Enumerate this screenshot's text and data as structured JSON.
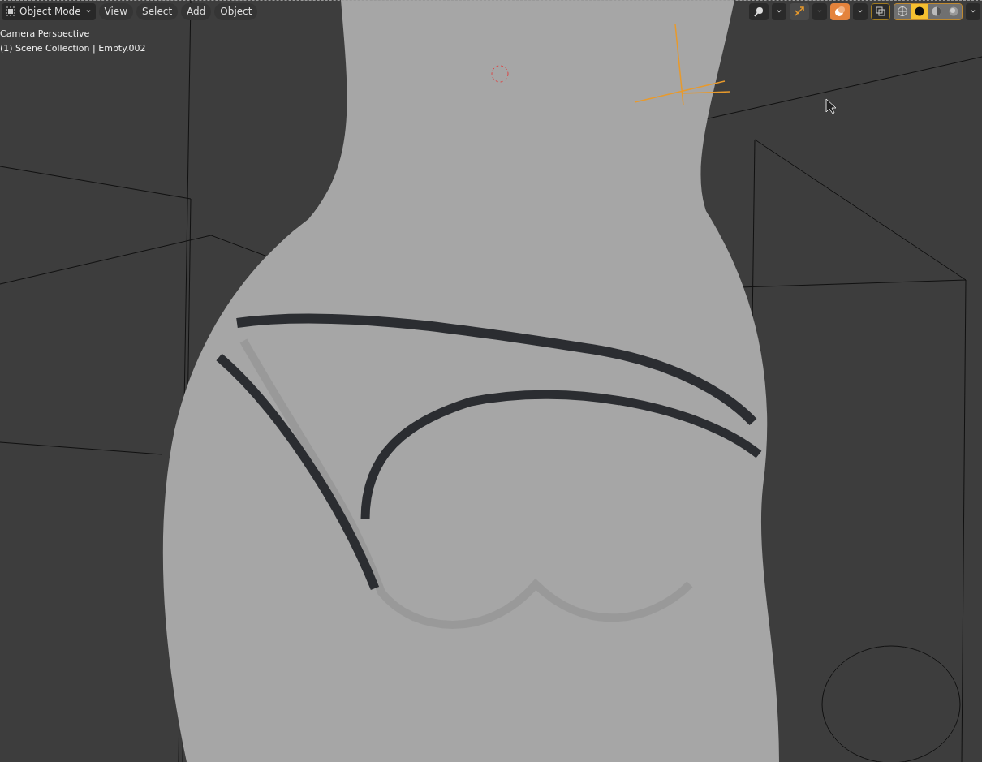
{
  "header": {
    "mode": {
      "label": "Object Mode"
    },
    "menus": [
      "View",
      "Select",
      "Add",
      "Object"
    ],
    "toggles": [
      {
        "kind": "visibility",
        "on": true
      },
      {
        "kind": "gizmo",
        "on": false
      },
      {
        "kind": "overlay",
        "on": true
      },
      {
        "kind": "xray",
        "on": false
      }
    ],
    "shading": [
      {
        "kind": "wireframe",
        "selected": false
      },
      {
        "kind": "solid",
        "selected": true
      },
      {
        "kind": "material",
        "selected": false
      },
      {
        "kind": "rendered",
        "selected": false
      }
    ]
  },
  "viewport": {
    "info": [
      "Camera Perspective",
      "(1) Scene Collection | Empty.002"
    ]
  }
}
